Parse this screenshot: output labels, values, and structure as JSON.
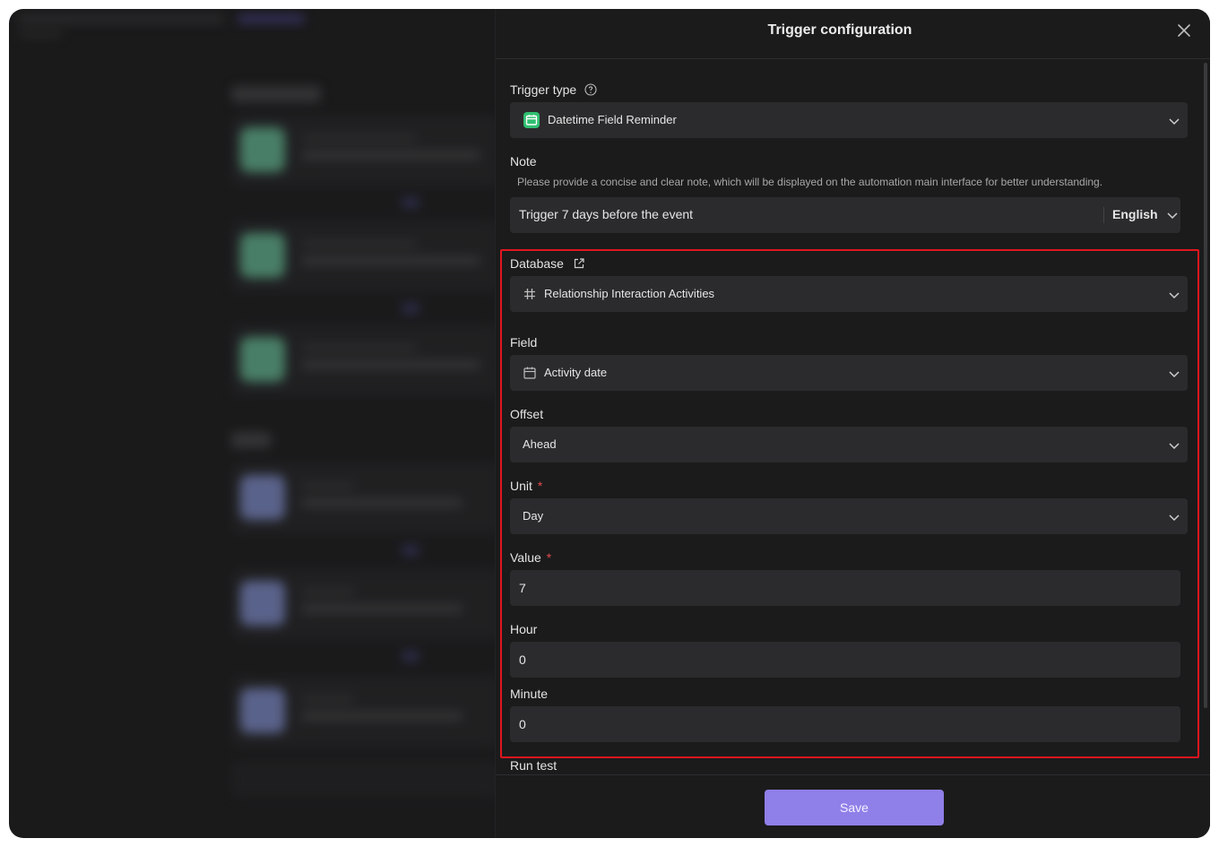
{
  "drawer": {
    "title": "Trigger configuration"
  },
  "trigger_type": {
    "label": "Trigger type",
    "value": "Datetime Field Reminder",
    "icon": "calendar-icon",
    "accent": "#2fbf71"
  },
  "note": {
    "label": "Note",
    "description": "Please provide a concise and clear note, which will be displayed on the automation main interface for better understanding.",
    "value": "Trigger 7 days before the event",
    "language": "English"
  },
  "database": {
    "label": "Database",
    "value": "Relationship Interaction Activities",
    "icon": "grid-icon"
  },
  "field": {
    "label": "Field",
    "value": "Activity date",
    "icon": "calendar-icon"
  },
  "offset": {
    "label": "Offset",
    "value": "Ahead"
  },
  "unit": {
    "label": "Unit",
    "required_mark": "*",
    "value": "Day"
  },
  "value_field": {
    "label": "Value",
    "required_mark": "*",
    "value": "7"
  },
  "hour": {
    "label": "Hour",
    "value": "0"
  },
  "minute": {
    "label": "Minute",
    "value": "0"
  },
  "run_test": {
    "label": "Run test"
  },
  "footer": {
    "save_label": "Save",
    "save_color": "#8f7fe8"
  },
  "highlight_color": "#e0161e"
}
